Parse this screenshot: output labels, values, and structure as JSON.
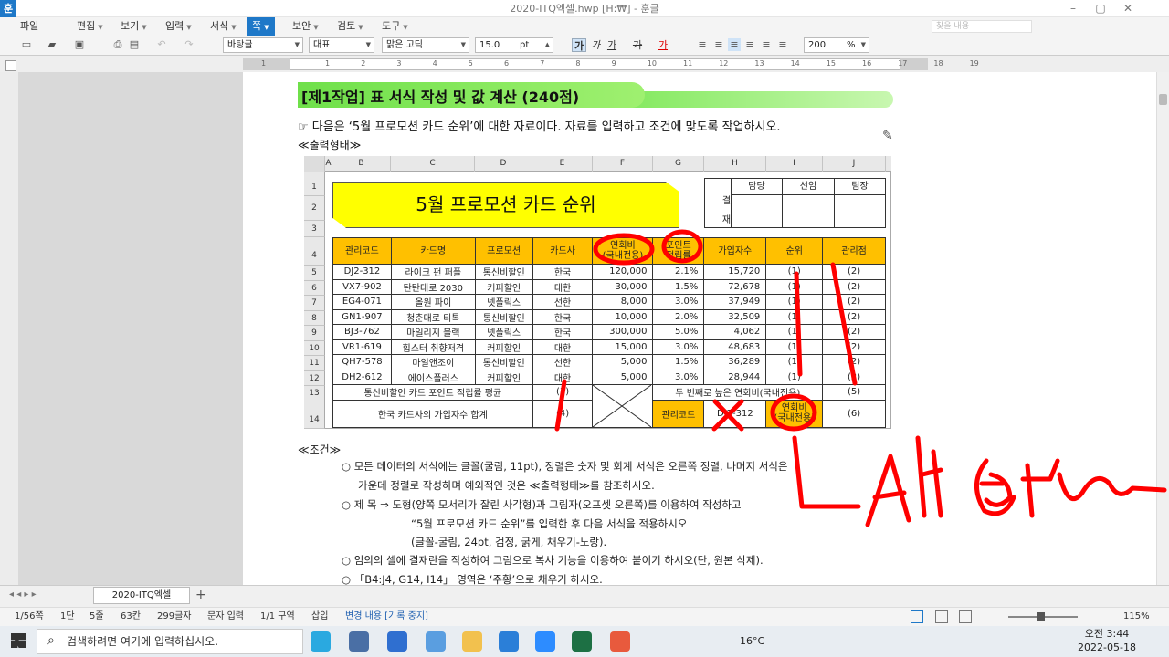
{
  "window": {
    "title": "2020-ITQ엑셀.hwp [H:₩] - 훈글",
    "app_icon": "훈",
    "min": "–",
    "max": "▢",
    "close": "✕"
  },
  "menus": [
    {
      "label": "파일"
    },
    {
      "label": "편집"
    },
    {
      "label": "보기"
    },
    {
      "label": "입력"
    },
    {
      "label": "서식"
    },
    {
      "label": "쪽"
    },
    {
      "label": "보안"
    },
    {
      "label": "검토"
    },
    {
      "label": "도구"
    }
  ],
  "help_placeholder": "찾을 내용",
  "toolbar": {
    "style_value": "바탕글",
    "lang_value": "대표",
    "font_value": "맑은 고딕",
    "size_value": "15.0",
    "size_unit": "pt",
    "zoom_value": "200",
    "zoom_unit": "%",
    "fmt": [
      "가",
      "가",
      "가",
      "가",
      "가"
    ]
  },
  "ruler_numbers": [
    "1",
    "1",
    "2",
    "3",
    "4",
    "5",
    "6",
    "7",
    "8",
    "9",
    "10",
    "11",
    "12",
    "13",
    "14",
    "15",
    "16",
    "17",
    "18",
    "19"
  ],
  "doc": {
    "heading": "[제1작업] 표 서식 작성 및 값 계산 (240점)",
    "intro": "☞  다음은 ‘5월 프로모션 카드 순위’에 대한 자료이다. 자료를 입력하고 조건에 맞도록 작업하시오.",
    "output_label": "≪출력형태≫",
    "sheet": {
      "col_headers": [
        "A",
        "B",
        "C",
        "D",
        "E",
        "F",
        "G",
        "H",
        "I",
        "J"
      ],
      "row_headers": [
        "1",
        "2",
        "3",
        "4",
        "5",
        "6",
        "7",
        "8",
        "9",
        "10",
        "11",
        "12",
        "13",
        "14"
      ],
      "title": "5월 프로모션 카드 순위",
      "approval": {
        "side": "결 재",
        "cols": [
          "담당",
          "선임",
          "팀장"
        ]
      },
      "table_headers": [
        "관리코드",
        "카드명",
        "프로모션",
        "카드사",
        "연회비\n(국내전용)",
        "포인트\n적립률",
        "가입자수",
        "순위",
        "관리점"
      ],
      "rows": [
        [
          "DJ2-312",
          "라이크 펀 퍼플",
          "통신비할인",
          "한국",
          "120,000",
          "2.1%",
          "15,720",
          "(1)",
          "(2)"
        ],
        [
          "VX7-902",
          "탄탄대로 2030",
          "커피할인",
          "대한",
          "30,000",
          "1.5%",
          "72,678",
          "(1)",
          "(2)"
        ],
        [
          "EG4-071",
          "올원 파이",
          "넷플릭스",
          "선한",
          "8,000",
          "3.0%",
          "37,949",
          "(1)",
          "(2)"
        ],
        [
          "GN1-907",
          "청춘대로 티톡",
          "통신비할인",
          "한국",
          "10,000",
          "2.0%",
          "32,509",
          "(1)",
          "(2)"
        ],
        [
          "BJ3-762",
          "마일리지 블랙",
          "넷플릭스",
          "한국",
          "300,000",
          "5.0%",
          "4,062",
          "(1)",
          "(2)"
        ],
        [
          "VR1-619",
          "힙스터 취향저격",
          "커피할인",
          "대한",
          "15,000",
          "3.0%",
          "48,683",
          "(1)",
          "(2)"
        ],
        [
          "QH7-578",
          "마일앤조이",
          "통신비할인",
          "선한",
          "5,000",
          "1.5%",
          "36,289",
          "(1)",
          "(2)"
        ],
        [
          "DH2-612",
          "에이스플러스",
          "커피할인",
          "대한",
          "5,000",
          "3.0%",
          "28,944",
          "(1)",
          "(2)"
        ]
      ],
      "summary": {
        "r13_label": "통신비할인 카드 포인트 적립률 평균",
        "r13_val": "(3)",
        "r13_right_label": "두 번째로 높은 연회비(국내전용)",
        "r13_right_val": "(5)",
        "r14_label": "한국 카드사의 가입자수 합계",
        "r14_val": "(4)",
        "r14_code_label": "관리코드",
        "r14_code_val": "DJ2-312",
        "r14_fee_label": "연회비\n(국내전용)",
        "r14_fee_val": "(6)"
      }
    },
    "conditions_label": "≪조건≫",
    "conditions": [
      "○  모든 데이터의 서식에는 글꼴(굴림, 11pt), 정렬은 숫자 및 회계 서식은 오른쪽 정렬, 나머지 서식은",
      "가운데 정렬로 작성하며 예외적인 것은 ≪출력형태≫를 참조하시오.",
      "○  제   목 ⇒ 도형(양쪽 모서리가 잘린 사각형)과 그림자(오프셋 오른쪽)를 이용하여 작성하고",
      "“5월 프로모션 카드 순위”를 입력한 후 다음 서식을 적용하시오",
      "(글꼴-굴림, 24pt, 검정, 굵게, 채우기-노랑).",
      "○  임의의 셀에 결재란을 작성하여 그림으로 복사 기능을 이용하여 붙이기 하시오(단, 원본 삭제).",
      "○ 「B4:J4, G14, I14」 영역은 ‘주황’으로 채우기 하시오."
    ]
  },
  "sheet_tab": "2020-ITQ엑셀",
  "status": [
    "1/56쪽",
    "1단",
    "5줄",
    "63칸",
    "299글자",
    "문자 입력",
    "1/1 구역",
    "삽입",
    "변경 내용 [기록 중지]"
  ],
  "zoom_status": "115%",
  "taskbar": {
    "search_placeholder": "검색하려면 여기에 입력하십시오.",
    "weather": "16°C",
    "time": "오전 3:44",
    "date": "2022-05-18"
  },
  "ink_color": "#ff0000"
}
